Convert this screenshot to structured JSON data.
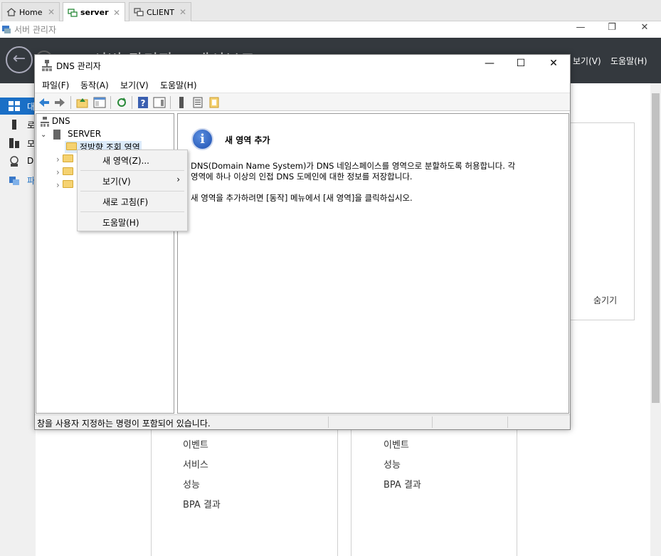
{
  "vm_tabs": [
    {
      "label": "Home",
      "icon": "home-icon"
    },
    {
      "label": "server",
      "icon": "vm-icon",
      "active": true
    },
    {
      "label": "CLIENT",
      "icon": "vm-icon"
    }
  ],
  "server_manager": {
    "window_title": "서버 관리자",
    "header_text": "서버 관리자 • 대시보드",
    "menu": {
      "view": "보기(V)",
      "help": "도움말(H)"
    },
    "sidebar": [
      {
        "label": "대",
        "icon": "dashboard-icon",
        "active": true
      },
      {
        "label": "로",
        "icon": "local-server-icon"
      },
      {
        "label": "모",
        "icon": "all-servers-icon"
      },
      {
        "label": "D",
        "icon": "dns-role-icon"
      },
      {
        "label": "파",
        "icon": "file-services-icon"
      }
    ],
    "hide_label": "숨기기",
    "tile1_links": [
      "이벤트",
      "서비스",
      "성능",
      "BPA 결과"
    ],
    "tile2_links": [
      "이벤트",
      "성능",
      "BPA 결과"
    ]
  },
  "dns_manager": {
    "title": "DNS 관리자",
    "menu": {
      "file": "파일(F)",
      "action": "동작(A)",
      "view": "보기(V)",
      "help": "도움말(H)"
    },
    "tree": {
      "root": "DNS",
      "server": "SERVER",
      "selected_zone": "정방향 조회 영역"
    },
    "detail": {
      "heading": "새 영역 추가",
      "para1_line1": "DNS(Domain Name System)가 DNS 네임스페이스를 영역으로 분할하도록 허용합니다. 각",
      "para1_line2": "영역에 하나 이상의 인접 DNS 도메인에 대한 정보를 저장합니다.",
      "para2": "새 영역을 추가하려면 [동작] 메뉴에서 [새 영역]을 클릭하십시오."
    },
    "status_text": "창을 사용자 지정하는 명령이 포함되어 있습니다."
  },
  "context_menu": {
    "new_zone": "새 영역(Z)...",
    "view": "보기(V)",
    "refresh": "새로 고침(F)",
    "help": "도움말(H)"
  }
}
